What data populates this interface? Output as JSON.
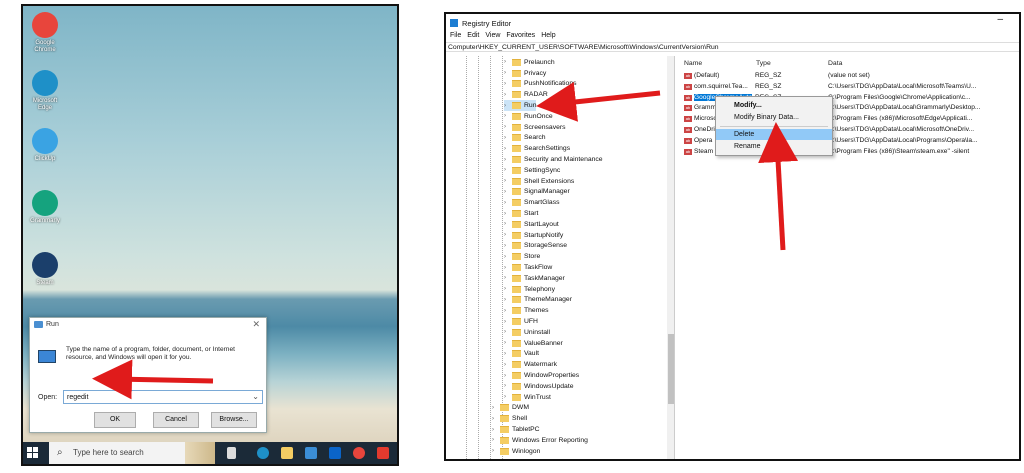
{
  "desktop": {
    "icons": [
      {
        "label": "Google Chrome",
        "icon": "chrome-icon",
        "color": "#e8453c"
      },
      {
        "label": "Microsoft Edge",
        "icon": "edge-icon",
        "color": "#1e90c8"
      },
      {
        "label": "ClickUp",
        "icon": "clickup-icon",
        "color": "#3aa3e3"
      },
      {
        "label": "Grammarly",
        "icon": "grammarly-icon",
        "color": "#15a37e"
      },
      {
        "label": "Steam",
        "icon": "steam-icon",
        "color": "#1b3f6b"
      }
    ],
    "run_dialog": {
      "title": "Run",
      "description": "Type the name of a program, folder, document, or Internet resource, and Windows will open it for you.",
      "open_label": "Open:",
      "open_value": "regedit",
      "ok_label": "OK",
      "cancel_label": "Cancel",
      "browse_label": "Browse..."
    },
    "taskbar": {
      "search_placeholder": "Type here to search"
    }
  },
  "regedit": {
    "title": "Registry Editor",
    "menu": [
      "File",
      "Edit",
      "View",
      "Favorites",
      "Help"
    ],
    "address": "Computer\\HKEY_CURRENT_USER\\SOFTWARE\\Microsoft\\Windows\\CurrentVersion\\Run",
    "tree": {
      "children": [
        "Prelaunch",
        "Privacy",
        "PushNotifications",
        "RADAR",
        "Run",
        "RunOnce",
        "Screensavers",
        "Search",
        "SearchSettings",
        "Security and Maintenance",
        "SettingSync",
        "Shell Extensions",
        "SignalManager",
        "SmartGlass",
        "Start",
        "StartLayout",
        "StartupNotify",
        "StorageSense",
        "Store",
        "TaskFlow",
        "TaskManager",
        "Telephony",
        "ThemeManager",
        "Themes",
        "UFH",
        "Uninstall",
        "ValueBanner",
        "Vault",
        "Watermark",
        "WindowProperties",
        "WindowsUpdate",
        "WinTrust"
      ],
      "parents": [
        "DWM",
        "Shell",
        "TabletPC",
        "Windows Error Reporting",
        "Winlogon"
      ],
      "selected": "Run"
    },
    "columns": {
      "name": "Name",
      "type": "Type",
      "data": "Data"
    },
    "values": [
      {
        "name": "(Default)",
        "type": "REG_SZ",
        "data": "(value not set)"
      },
      {
        "name": "com.squirrel.Tea...",
        "type": "REG_SZ",
        "data": "C:\\Users\\TDG\\AppData\\Local\\Microsoft\\Teams\\U..."
      },
      {
        "name": "GoogleChromeAuto...",
        "type": "REG_SZ",
        "data": "C:\\Program Files\\Google\\Chrome\\Application\\c..."
      },
      {
        "name": "Grammarly",
        "type": "REG_SZ",
        "data": "C:\\Users\\TDG\\AppData\\Local\\Grammarly\\Desktop..."
      },
      {
        "name": "MicrosoftEdgeAuto...",
        "type": "REG_SZ",
        "data": "C:\\Program Files (x86)\\Microsoft\\Edge\\Applicati..."
      },
      {
        "name": "OneDrive",
        "type": "REG_SZ",
        "data": "C:\\Users\\TDG\\AppData\\Local\\Microsoft\\OneDriv..."
      },
      {
        "name": "Opera",
        "type": "REG_SZ",
        "data": "C:\\Users\\TDG\\AppData\\Local\\Programs\\Opera\\la..."
      },
      {
        "name": "Steam",
        "type": "REG_SZ",
        "data": "C:\\Program Files (x86)\\Steam\\steam.exe\" -silent"
      }
    ],
    "context_menu": {
      "modify": "Modify...",
      "modify_binary": "Modify Binary Data...",
      "delete": "Delete",
      "rename": "Rename"
    }
  },
  "colors": {
    "arrow": "#e01b1b",
    "selection": "#0078d7",
    "menu_highlight": "#91c9f7"
  }
}
